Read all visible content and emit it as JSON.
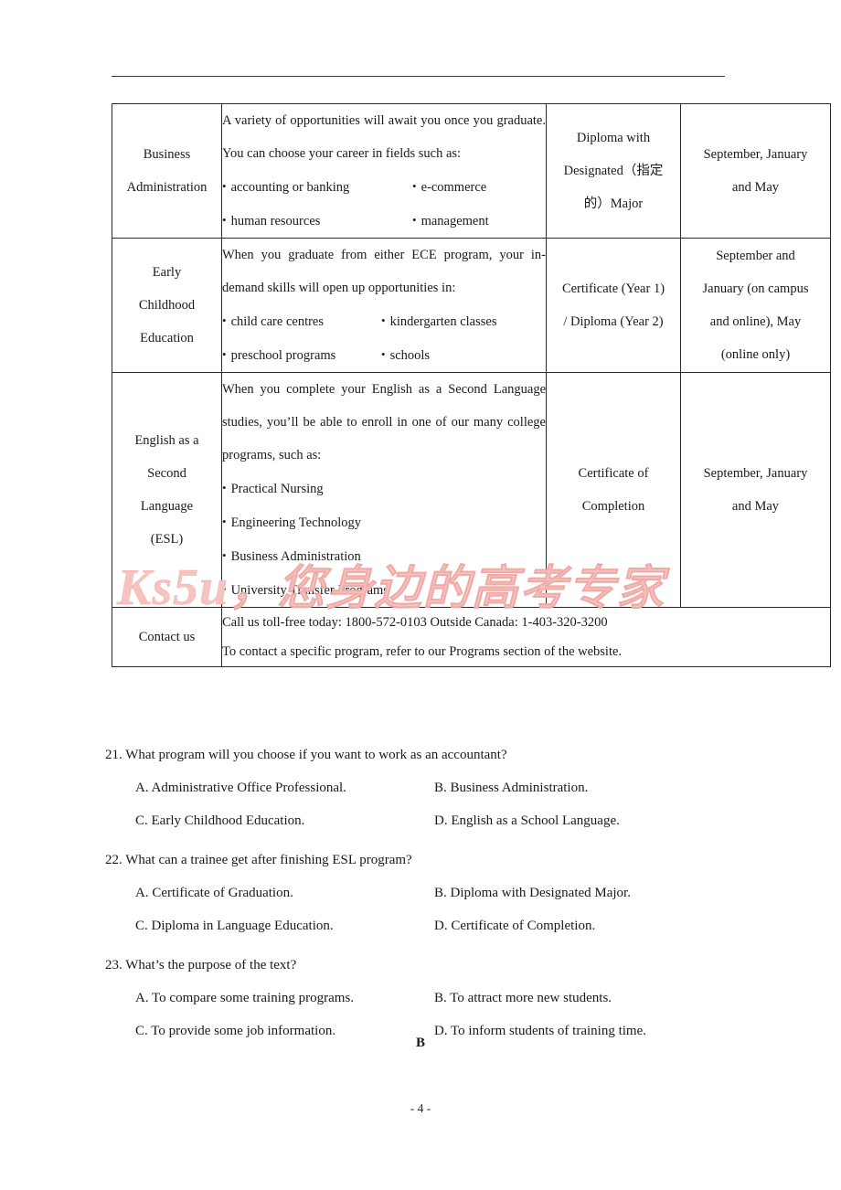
{
  "page": {
    "footer_page_number": "- 4 -",
    "answer_mark": "B",
    "watermark_en": "Ks5u",
    "watermark_cn": "，您身边的高考专家",
    "watermark_color": "#f7c3c0"
  },
  "table": {
    "rows": [
      {
        "program": [
          "Business",
          "Administration"
        ],
        "intro": "A variety of opportunities will await you once you graduate. You can choose your career in fields such as:",
        "bullets_grid": [
          [
            "accounting or banking",
            "e-commerce"
          ],
          [
            "human resources",
            "management"
          ]
        ],
        "credential": [
          "Diploma with",
          "Designated（指定",
          "的）Major"
        ],
        "start_dates": [
          "September, January",
          "and May"
        ]
      },
      {
        "program": [
          "Early",
          "Childhood",
          "Education"
        ],
        "intro": "When you graduate from either ECE program, your in-demand skills will open up opportunities in:",
        "bullets_grid": [
          [
            "child care centres",
            "kindergarten classes"
          ],
          [
            "preschool programs",
            "schools"
          ]
        ],
        "credential": [
          "Certificate (Year 1)",
          "/ Diploma (Year 2)"
        ],
        "start_dates": [
          "September and",
          "January (on campus",
          "and online), May",
          "(online only)"
        ]
      },
      {
        "program": [
          "English as a",
          "Second",
          "Language",
          "(ESL)"
        ],
        "intro": "When you complete your English as a Second Language studies, you’ll be able to enroll in one of our many college programs, such as:",
        "bullets_list": [
          "Practical Nursing",
          "Engineering Technology",
          "Business Administration",
          "University Transfer Programs"
        ],
        "credential": [
          "Certificate of",
          "Completion"
        ],
        "start_dates": [
          "September, January",
          "and May"
        ]
      }
    ],
    "contact": {
      "label": "Contact us",
      "lines": [
        "Call us toll-free today: 1800-572-0103 Outside Canada: 1-403-320-3200",
        "To contact a specific program, refer to our Programs section of the website."
      ]
    }
  },
  "questions": [
    {
      "stem": "21. What program will you choose if you want to work as an accountant?",
      "options": [
        "A. Administrative Office Professional.",
        "B. Business Administration.",
        "C. Early Childhood Education.",
        "D. English as a School Language."
      ]
    },
    {
      "stem": "22. What can a trainee get after finishing ESL program?",
      "options": [
        "A. Certificate of Graduation.",
        "B. Diploma with Designated Major.",
        "C. Diploma in Language Education.",
        "D. Certificate of Completion."
      ]
    },
    {
      "stem": "23. What’s the purpose of the text?",
      "options": [
        "A. To compare some training programs.",
        "B. To attract more new students.",
        "C. To provide some job information.",
        "D. To inform students of training time."
      ]
    }
  ]
}
